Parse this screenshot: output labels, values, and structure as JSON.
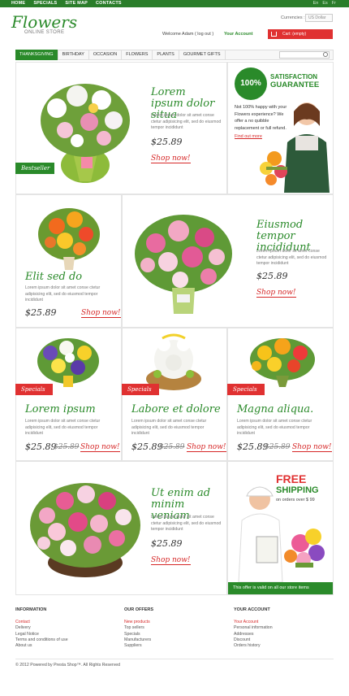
{
  "topnav": [
    "HOME",
    "SPECIALS",
    "SITE MAP",
    "CONTACTS"
  ],
  "languages": [
    "En",
    "Es",
    "Fr"
  ],
  "logo": {
    "text": "Flowers",
    "sub": "ONLINE STORE"
  },
  "header": {
    "currency_label": "Currencies :",
    "currency_value": "US Dollar",
    "welcome": "Welcome  Adam  ( log out )",
    "account": "Your Account",
    "cart": "Cart: (empty)"
  },
  "categories": [
    "THANKSGIVING",
    "BIRTHDAY",
    "OCCASION",
    "FLOWERS",
    "PLANTS",
    "GOURMET GIFTS"
  ],
  "colors": {
    "green": "#2a8a2a",
    "red": "#e03131"
  },
  "feature1": {
    "title": "Lorem ipsum dolor situa",
    "desc": "Lorem ipsum dolor sit amet conse ctetur adipisicing elit, sed do eiusmod tempor incididunt",
    "price": "$25.89",
    "shop": "Shop now!",
    "ribbon": "Bestseller"
  },
  "guarantee": {
    "badge": "100%",
    "title1": "SATISFACTION",
    "title2": "GUARANTEE",
    "text": "Not 100% happy with your Flowers experience? We offer a no quibble replacement or full refund.",
    "link": "Find out more"
  },
  "item2": {
    "title": "Elit sed do",
    "desc": "Lorem ipsum dolor sit amet conse ctetur adipisicing elit, sed do eiusmod tempor incididunt",
    "price": "$25.89",
    "shop": "Shop now!"
  },
  "item3": {
    "title": "Eiusmod tempor incididunt",
    "desc": "Lorem ipsum dolor sit amet conse ctetur adipisicing elit, sed do eiusmod tempor incididunt",
    "price": "$25.89",
    "shop": "Shop now!"
  },
  "specials": [
    {
      "ribbon": "Specials",
      "title": "Lorem ipsum",
      "desc": "Lorem ipsum dolor sit amet conse ctetur adipisicing elit, sed do eiusmod tempor incididunt",
      "price": "$25.89",
      "old": "$25.89",
      "shop": "Shop now!"
    },
    {
      "ribbon": "Specials",
      "title": "Labore et dolore",
      "desc": "Lorem ipsum dolor sit amet conse ctetur adipisicing elit, sed do eiusmod tempor incididunt",
      "price": "$25.89",
      "old": "$25.89",
      "shop": "Shop now!"
    },
    {
      "ribbon": "Specials",
      "title": "Magna aliqua.",
      "desc": "Lorem ipsum dolor sit amet conse ctetur adipisicing elit, sed do eiusmod tempor incididunt",
      "price": "$25.89",
      "old": "$25.89",
      "shop": "Shop now!"
    }
  ],
  "feature4": {
    "title": "Ut enim ad minim veniam",
    "desc": "Lorem ipsum dolor sit amet conse ctetur adipisicing elit, sed do eiusmod tempor incididunt",
    "price": "$25.89",
    "shop": "Shop now!"
  },
  "shipping": {
    "free": "FREE",
    "shipping": "SHIPPING",
    "sub": "on orders over $ 99",
    "bar": "This offer is valid on all our  store items"
  },
  "footer": {
    "col1": {
      "title": "INFORMATION",
      "links": [
        "Contact",
        "Delivery",
        "Legal Notice",
        "Terms and conditions of use",
        "About us"
      ]
    },
    "col2": {
      "title": "OUR OFFERS",
      "links": [
        "New products",
        "Top sellers",
        "Specials",
        "Manufacturers",
        "Suppliers"
      ]
    },
    "col3": {
      "title": "YOUR ACCOUNT",
      "links": [
        "Your Account",
        "Personal information",
        "Addresses",
        "Discount",
        "Orders history"
      ]
    },
    "copyright": "© 2012 Powered by Presta Shop™.  All Rights Reserved"
  }
}
